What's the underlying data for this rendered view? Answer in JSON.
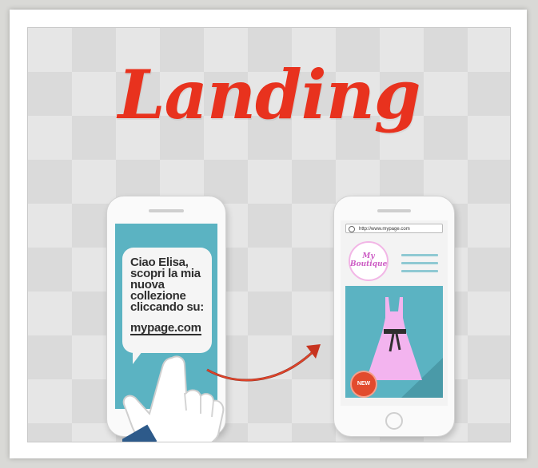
{
  "title": "Landing",
  "sms_phone": {
    "message_lines": [
      "Ciao Elisa,",
      "scopri la mia",
      "nuova",
      "collezione",
      "cliccando su:"
    ],
    "link": "mypage.com"
  },
  "web_phone": {
    "url": "http://www.mypage.com",
    "logo_line1": "My",
    "logo_line2": "Boutique",
    "badge": "NEW",
    "nav_arrows": "< >"
  },
  "colors": {
    "title_red": "#e8321e",
    "screen_teal": "#5bb3c2",
    "dress_pink": "#f3b4ef",
    "badge_red": "#e24b2d"
  },
  "icons": [
    "hand-pointer-icon",
    "curved-arrow-icon",
    "dress-icon",
    "search-icon"
  ]
}
